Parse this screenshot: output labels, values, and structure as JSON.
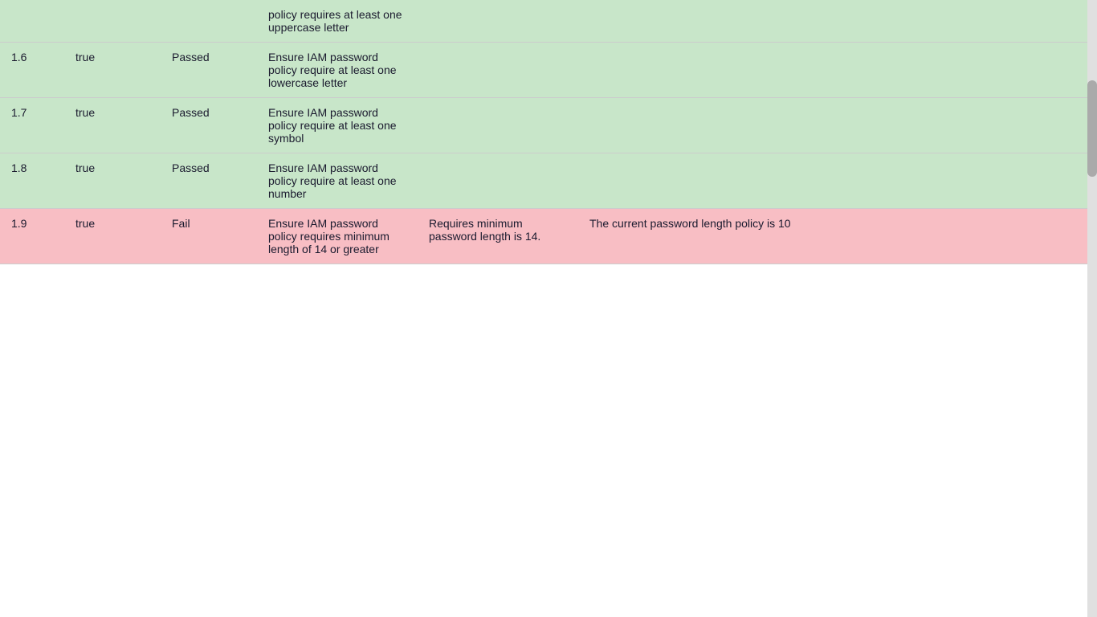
{
  "table": {
    "rows": [
      {
        "id": "",
        "bool": "",
        "status": "",
        "check": "policy requires at least one uppercase letter",
        "expected": "",
        "actual": "",
        "type": "pass",
        "partial": true
      },
      {
        "id": "1.6",
        "bool": "true",
        "status": "Passed",
        "check": "Ensure IAM password policy require at least one lowercase letter",
        "expected": "",
        "actual": "",
        "type": "pass",
        "partial": false
      },
      {
        "id": "1.7",
        "bool": "true",
        "status": "Passed",
        "check": "Ensure IAM password policy require at least one symbol",
        "expected": "",
        "actual": "",
        "type": "pass",
        "partial": false
      },
      {
        "id": "1.8",
        "bool": "true",
        "status": "Passed",
        "check": "Ensure IAM password policy require at least one number",
        "expected": "",
        "actual": "",
        "type": "pass",
        "partial": false
      },
      {
        "id": "1.9",
        "bool": "true",
        "status": "Fail",
        "check": "Ensure IAM password policy requires minimum length of 14 or greater",
        "expected": "Requires minimum password length is 14.",
        "actual": "The current password length policy is 10",
        "type": "fail",
        "partial": false
      }
    ]
  }
}
